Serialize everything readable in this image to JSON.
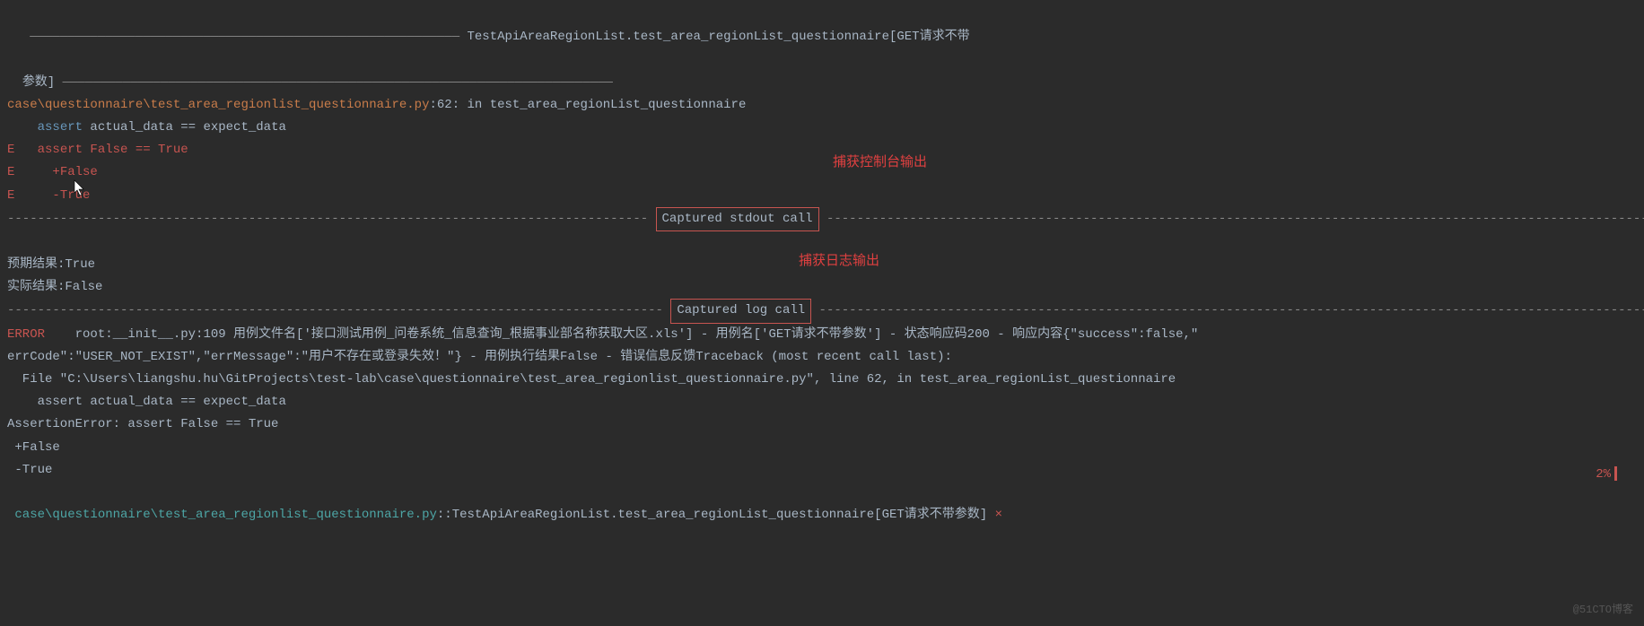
{
  "header": {
    "test_name": "TestApiAreaRegionList.test_area_regionList_questionnaire[GET请求不带",
    "test_name_cont": "参数]"
  },
  "trace": {
    "path": "case\\questionnaire\\test_area_regionlist_questionnaire.py",
    "location": ":62: in test_area_regionList_questionnaire",
    "assert_keyword": "assert",
    "assert_line": " actual_data == expect_data",
    "e": "E",
    "fail1": "   assert False == True",
    "fail2": "     +False",
    "fail3": "     -True"
  },
  "sections": {
    "stdout": "Captured stdout call",
    "log": "Captured log call"
  },
  "annotations": {
    "stdout": "捕获控制台输出",
    "log": "捕获日志输出"
  },
  "stdout_results": {
    "expected": "预期结果:True",
    "actual": "实际结果:False"
  },
  "log": {
    "level": "ERROR",
    "logger": "    root:__init__.py:109 用例文件名['接口测试用例_问卷系统_信息查询_根据事业部名称获取大区.xls'] - 用例名['GET请求不带参数'] - 状态响应码200 - 响应内容{\"success\":false,\"",
    "line2": "errCode\":\"USER_NOT_EXIST\",\"errMessage\":\"用户不存在或登录失效！\"} - 用例执行结果False - 错误信息反馈Traceback (most recent call last):",
    "line3": "  File \"C:\\Users\\liangshu.hu\\GitProjects\\test-lab\\case\\questionnaire\\test_area_regionlist_questionnaire.py\", line 62, in test_area_regionList_questionnaire",
    "line4": "    assert actual_data == expect_data",
    "line5": "AssertionError: assert False == True",
    "line6": " +False",
    "line7": " -True"
  },
  "footer": {
    "path": " case\\questionnaire\\test_area_regionlist_questionnaire.py",
    "sep": "::",
    "test": "TestApiAreaRegionList.test_area_regionList_questionnaire[GET请求不带参数]",
    "x": " ×"
  },
  "percent": "2%",
  "watermark": "@51CTO博客"
}
